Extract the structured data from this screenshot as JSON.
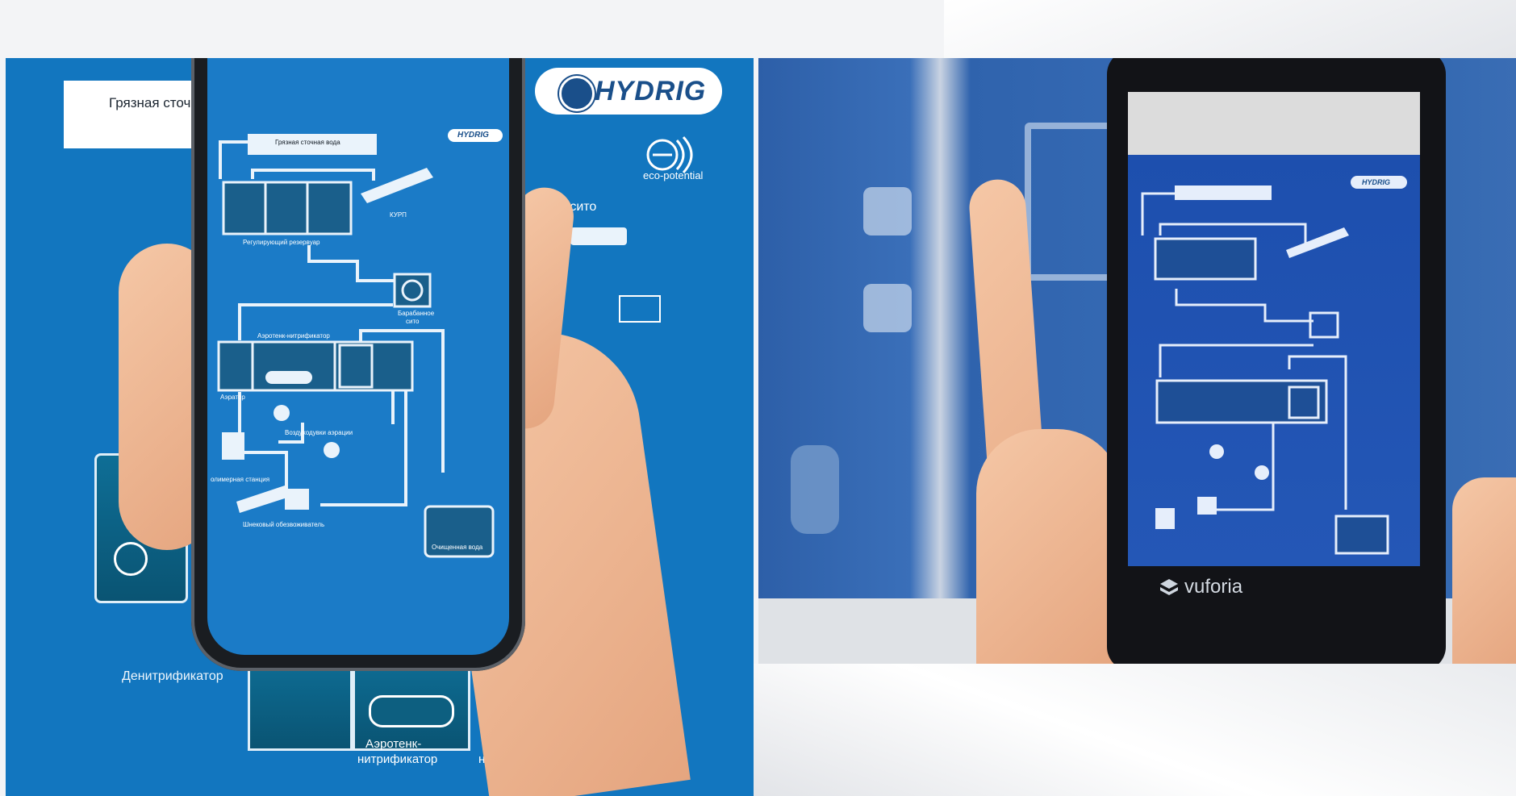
{
  "left_poster": {
    "brand": "HYDRIG",
    "eco_brand": "eco-potential",
    "dirty_water_partial": "Грязная сточ",
    "sieve_partial": "е сито",
    "denitrifier": "Денитрификатор",
    "aerotank_line1": "Аэротенк-",
    "aerotank_line2": "нитрификатор",
    "pump_partial1": "Н",
    "pump_partial2": "нас"
  },
  "phone_screen": {
    "brand": "HYDRIG",
    "dirty_water": "Грязная сточная вода",
    "kurp": "КУРП",
    "reg_tank": "Регулирующий резервуар",
    "drum_sieve_1": "Барабанное",
    "drum_sieve_2": "сито",
    "aerotank": "Аэротенк-нитрификатор",
    "aerator": "Аэратор",
    "blowers": "Воздуходувки аэрации",
    "polymer_station": "олимерная станция",
    "screw_dewaterer": "Шнековый обезвоживатель",
    "clean_water": "Очищенная вода"
  },
  "right_photo": {
    "watermark": "vuforia",
    "brand": "HYDRIG"
  }
}
